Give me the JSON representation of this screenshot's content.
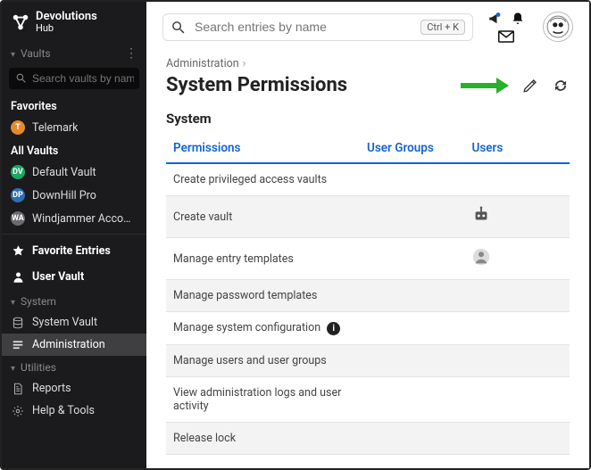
{
  "brand": {
    "name": "Devolutions",
    "sub": "Hub"
  },
  "sidebar": {
    "vaults_heading": "Vaults",
    "search_placeholder": "Search vaults by name",
    "favorites_label": "Favorites",
    "favorites": [
      {
        "label": "Telemark",
        "badge": "T",
        "color": "b-orange"
      }
    ],
    "all_vaults_label": "All Vaults",
    "all_vaults": [
      {
        "label": "Default Vault",
        "badge": "DV",
        "color": "b-green"
      },
      {
        "label": "DownHill Pro",
        "badge": "DP",
        "color": "b-blue"
      },
      {
        "label": "Windjammer Acco…",
        "badge": "WA",
        "color": "b-grey"
      }
    ],
    "favorite_entries": "Favorite Entries",
    "user_vault": "User Vault",
    "system_heading": "System",
    "system_items": [
      {
        "label": "System Vault",
        "icon": "db"
      },
      {
        "label": "Administration",
        "icon": "list",
        "active": true
      }
    ],
    "utilities_heading": "Utilities",
    "utilities_items": [
      {
        "label": "Reports",
        "icon": "doc"
      },
      {
        "label": "Help & Tools",
        "icon": "gear"
      }
    ]
  },
  "topbar": {
    "search_placeholder": "Search entries by name",
    "shortcut": "Ctrl + K"
  },
  "breadcrumb": {
    "root": "Administration"
  },
  "page": {
    "title": "System Permissions",
    "section": "System"
  },
  "table": {
    "headers": {
      "perm": "Permissions",
      "groups": "User Groups",
      "users": "Users"
    },
    "rows": [
      {
        "perm": "Create privileged access vaults",
        "users": ""
      },
      {
        "perm": "Create vault",
        "users": "robot"
      },
      {
        "perm": "Manage entry templates",
        "users": "person"
      },
      {
        "perm": "Manage password templates",
        "users": ""
      },
      {
        "perm": "Manage system configuration",
        "info": true,
        "users": ""
      },
      {
        "perm": "Manage users and user groups",
        "users": ""
      },
      {
        "perm": "View administration logs and user activity",
        "users": ""
      },
      {
        "perm": "Release lock",
        "users": ""
      }
    ]
  }
}
